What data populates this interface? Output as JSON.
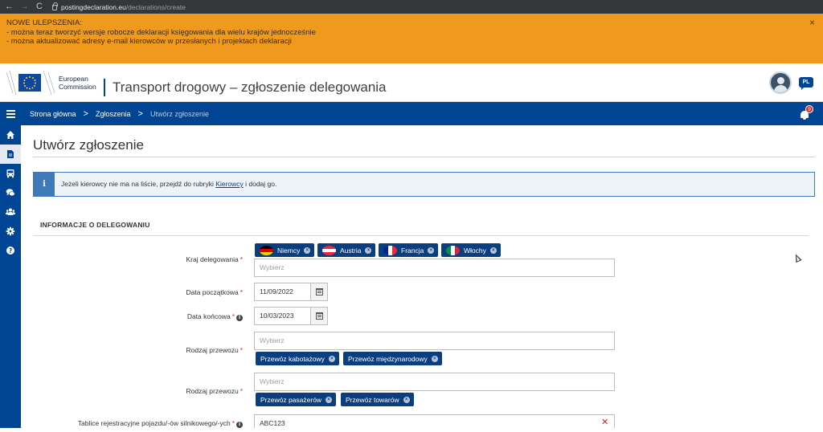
{
  "browser": {
    "back": "←",
    "forward": "→",
    "reload": "C",
    "url_domain": "postingdeclaration.eu",
    "url_path": "/declarations/create"
  },
  "banner": {
    "heading": "NOWE ULEPSZENIA:",
    "line1": "- można teraz tworzyć wersje robocze deklaracji księgowania dla wielu krajów jednocześnie",
    "line2": "- można aktualizować adresy e-mail kierowców w przesłanych i projektach deklaracji",
    "close": "×",
    "color": "#ef9a1c"
  },
  "header": {
    "logo_line1": "European",
    "logo_line2": "Commission",
    "site_title": "Transport drogowy – zgłoszenie delegowania",
    "language": "PL",
    "brand_color": "#004494"
  },
  "breadcrumb": {
    "home": "Strona główna",
    "level2": "Zgłoszenia",
    "current": "Utwórz zgłoszenie",
    "separator": ">",
    "notification_count": "9"
  },
  "sidebar": {
    "icons": [
      "home-icon",
      "document-icon",
      "bus-icon",
      "comments-icon",
      "users-icon",
      "gear-icon",
      "help-icon"
    ]
  },
  "main": {
    "page_title": "Utwórz zgłoszenie",
    "info_icon": "i",
    "info_text_before": "Jeżeli kierowcy nie ma na liście, przejdź do rubryki ",
    "info_link": "Kierowcy",
    "info_text_after": " i dodaj go.",
    "section_title": "INFORMACJE O DELEGOWANIU"
  },
  "form": {
    "required_mark": "*",
    "info_mark": "i",
    "country": {
      "label": "Kraj delegowania",
      "placeholder": "Wybierz",
      "tags": [
        "Niemcy",
        "Austria",
        "Francja",
        "Włochy"
      ]
    },
    "start_date": {
      "label": "Data początkowa",
      "value": "11/09/2022"
    },
    "end_date": {
      "label": "Data końcowa",
      "value": "10/03/2023"
    },
    "transport_type": {
      "label": "Rodzaj przewozu",
      "placeholder": "Wybierz",
      "tags": [
        "Przewóz kabotażowy",
        "Przewóz międzynarodowy"
      ]
    },
    "transport_kind": {
      "label": "Rodzaj przewozu",
      "placeholder": "Wybierz",
      "tags": [
        "Przewóz pasażerów",
        "Przewóz towarów"
      ]
    },
    "plates": {
      "label": "Tablice rejestracyjne pojazdu/-ów silnikowego/-ych",
      "value": "ABC123",
      "clear": "✕"
    },
    "tag_remove": "×"
  }
}
